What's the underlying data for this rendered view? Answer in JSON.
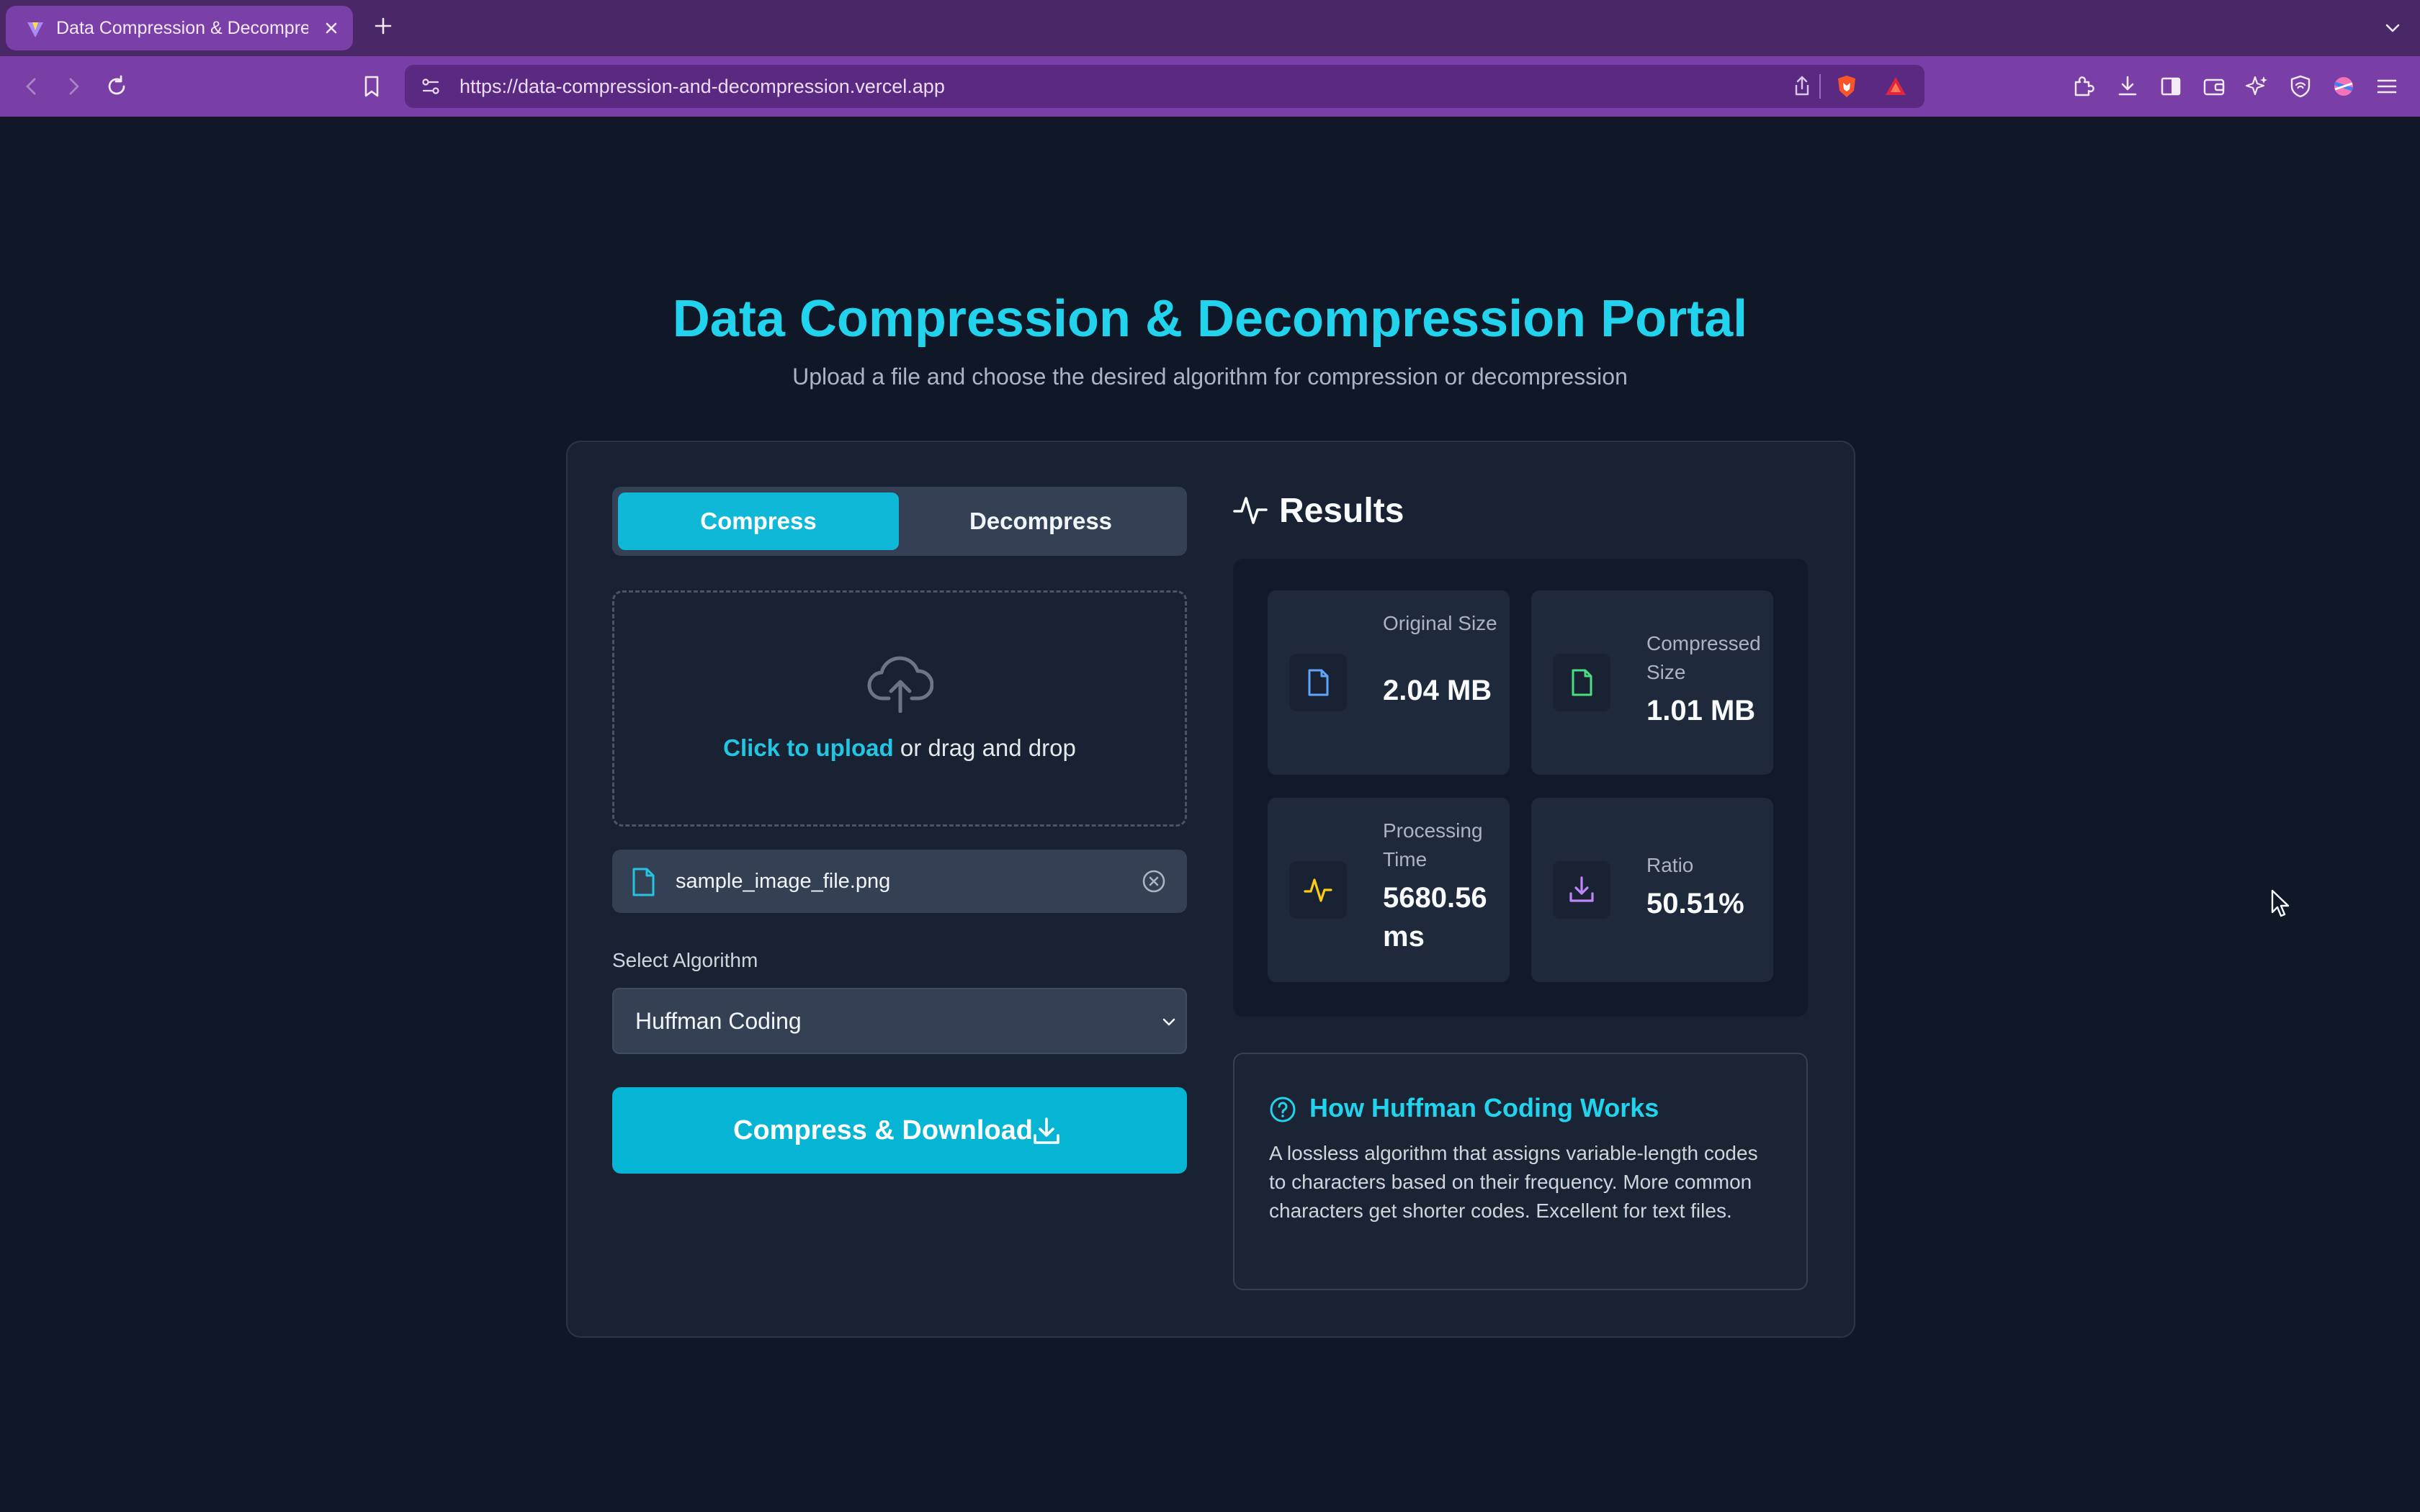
{
  "browser": {
    "tab_title": "Data Compression & Decompression Portal",
    "url": "https://data-compression-and-decompression.vercel.app",
    "icons": [
      "back-icon",
      "forward-icon",
      "reload-icon",
      "bookmark-icon",
      "site-settings-icon",
      "share-icon",
      "brave-shields-icon",
      "brave-rewards-icon",
      "extensions-icon",
      "downloads-icon",
      "sidebar-icon",
      "wallet-icon",
      "leo-ai-icon",
      "vpn-icon",
      "profile-icon",
      "menu-icon"
    ]
  },
  "header": {
    "title": "Data Compression & Decompression Portal",
    "subtitle": "Upload a file and choose the desired algorithm for compression or decompression"
  },
  "mode": {
    "compress_label": "Compress",
    "decompress_label": "Decompress",
    "selected": "Compress"
  },
  "upload": {
    "link_text": "Click to upload",
    "rest_text": " or drag and drop"
  },
  "file": {
    "name": "sample_image_file.png"
  },
  "algorithm": {
    "label": "Select Algorithm",
    "selected": "Huffman Coding"
  },
  "action": {
    "label": "Compress & Download"
  },
  "results": {
    "title": "Results",
    "stats": [
      {
        "label": "Original Size",
        "value": "2.04 MB",
        "color": "#60a5fa",
        "icon": "file-icon"
      },
      {
        "label": "Compressed Size",
        "value": "1.01 MB",
        "color": "#4ade80",
        "icon": "file-icon"
      },
      {
        "label": "Processing Time",
        "value": "5680.56 ms",
        "color": "#facc15",
        "icon": "activity-icon"
      },
      {
        "label": "Ratio",
        "value": "50.51%",
        "color": "#c084fc",
        "icon": "download-icon"
      }
    ]
  },
  "info": {
    "title": "How Huffman Coding Works",
    "text": "A lossless algorithm that assigns variable-length codes to characters based on their frequency. More common characters get shorter codes. Excellent for text files."
  },
  "colors": {
    "accent": "#22d3ee",
    "button": "#06b4d4",
    "background": "#101828",
    "card": "#182233",
    "tabbar": "#4a2868",
    "toolbar": "#7a3fa6"
  }
}
